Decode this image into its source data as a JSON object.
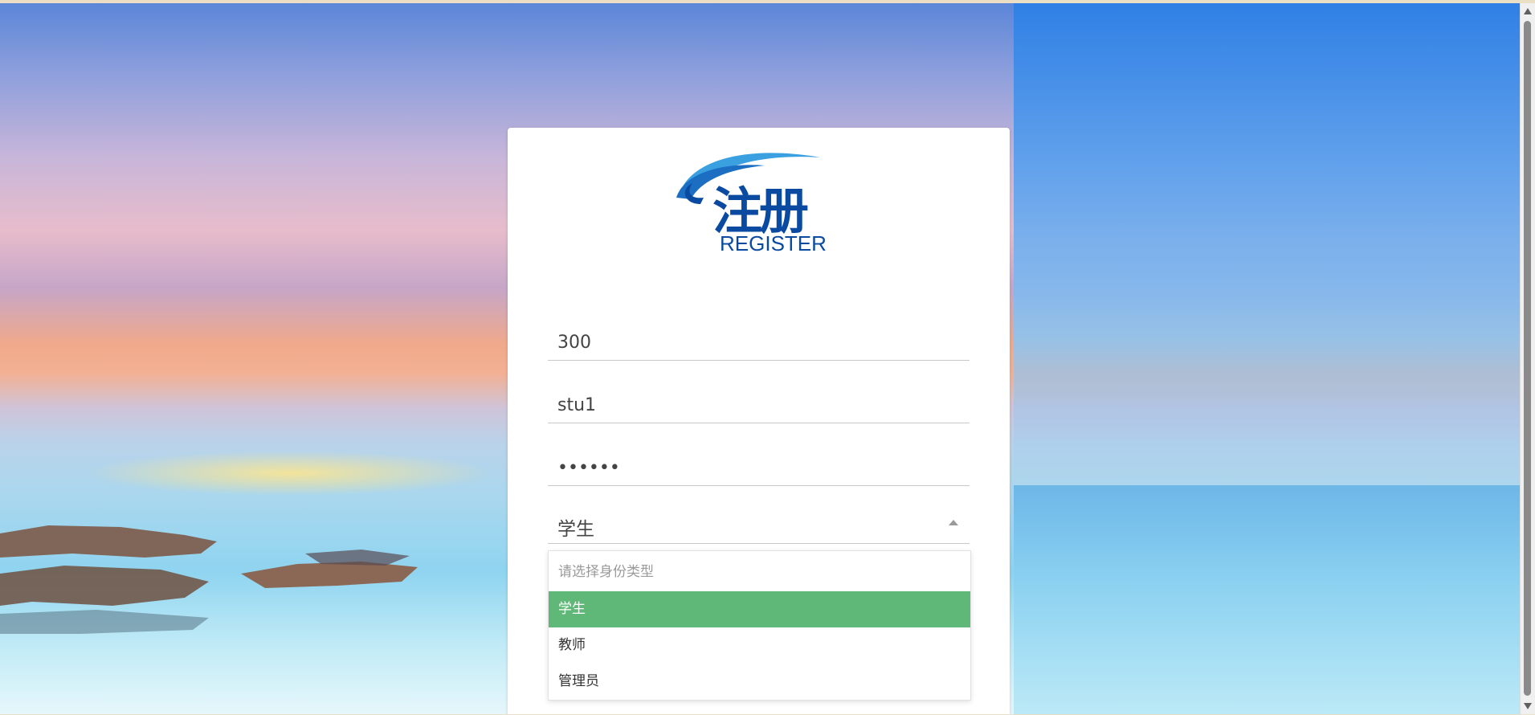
{
  "form": {
    "logo": {
      "title_cn": "注册",
      "subtitle_en": "REGISTER"
    },
    "fields": {
      "id_value": "300",
      "username_value": "stu1",
      "password_value": "••••••"
    },
    "role_select": {
      "selected": "学生",
      "placeholder": "请选择身份类型",
      "options": [
        "学生",
        "教师",
        "管理员"
      ]
    }
  },
  "colors": {
    "option_selected_bg": "#5fb878",
    "logo_blue": "#0a4aa0",
    "logo_wave": "#3aa0e0"
  }
}
